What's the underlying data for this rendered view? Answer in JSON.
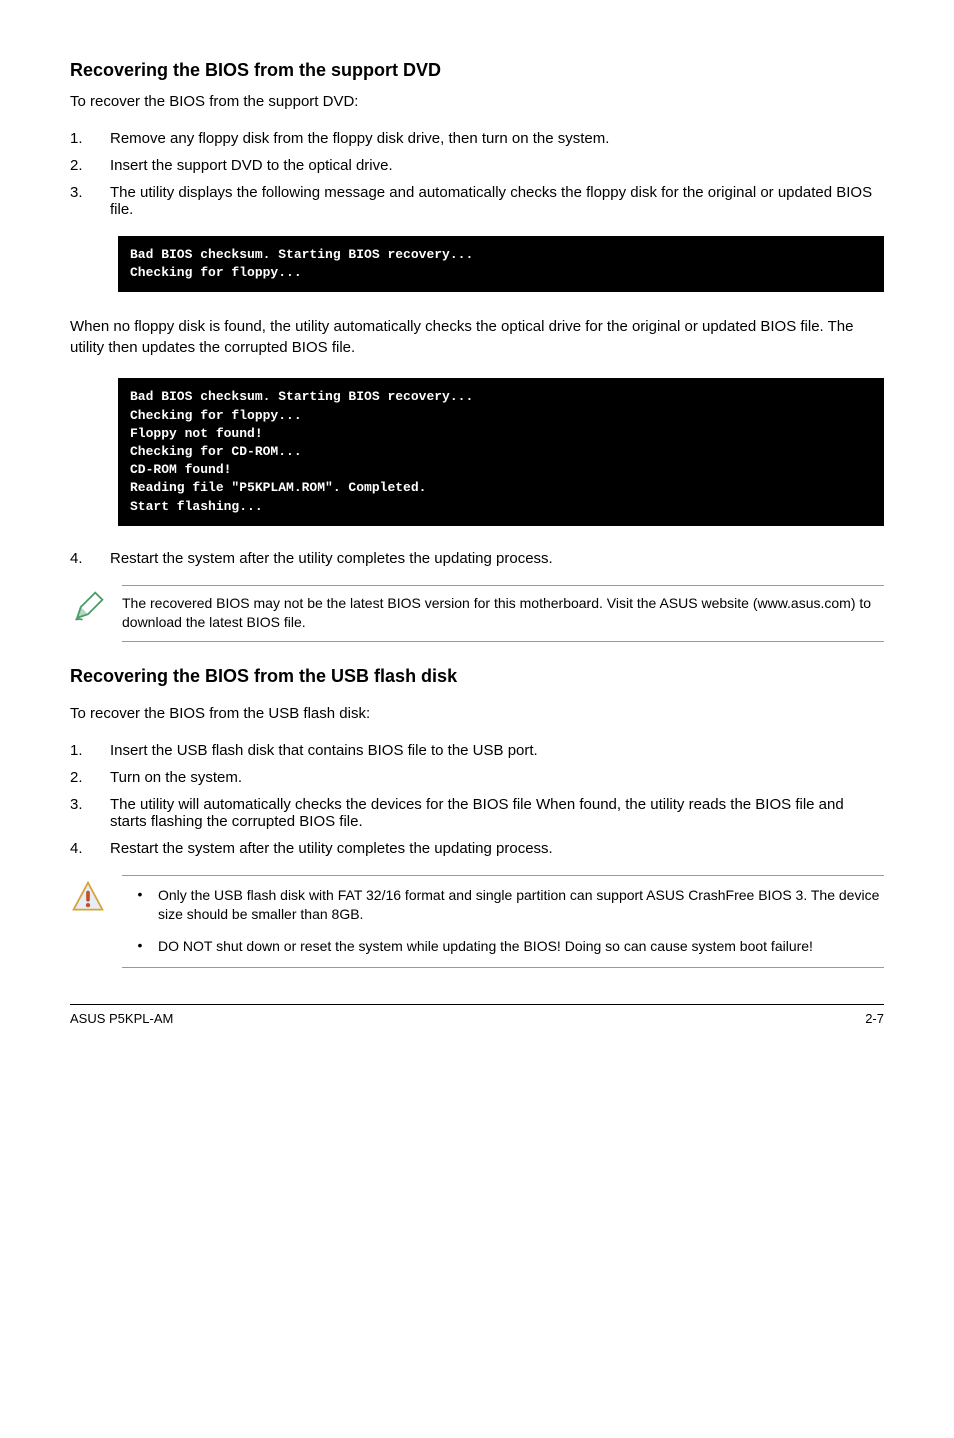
{
  "section1": {
    "heading": "Recovering the BIOS from the support DVD",
    "lead": "To recover the BIOS from the support DVD:",
    "steps": [
      "Remove any floppy disk from the floppy disk drive, then turn on the system.",
      "Insert the support DVD to the optical drive.",
      "The utility displays the following message and automatically checks the floppy disk for the original or updated BIOS file."
    ],
    "code1": "Bad BIOS checksum. Starting BIOS recovery...\nChecking for floppy...",
    "paragraph": "When no floppy disk is found, the utility automatically checks the optical drive for the original or updated BIOS file. The utility then updates the corrupted BIOS file.",
    "code2": "Bad BIOS checksum. Starting BIOS recovery...\nChecking for floppy...\nFloppy not found!\nChecking for CD-ROM...\nCD-ROM found!\nReading file \"P5KPLAM.ROM\". Completed.\nStart flashing...",
    "step4": "Restart the system after the utility completes the updating process.",
    "note": "The recovered BIOS may not be the latest BIOS version for this motherboard. Visit the ASUS website (www.asus.com) to download the latest BIOS file."
  },
  "section2": {
    "heading": "Recovering the BIOS from the USB flash disk",
    "lead": "To recover the BIOS from the USB flash disk:",
    "steps": [
      "Insert the USB flash disk that contains BIOS file to the USB port.",
      "Turn on the system.",
      "The utility will automatically checks the devices for the BIOS file When found, the utility reads the BIOS file and starts flashing the corrupted BIOS file.",
      "Restart the system after the utility completes the updating process."
    ],
    "warnings": [
      "Only the USB flash disk with FAT 32/16 format and single partition can support ASUS CrashFree BIOS 3. The device size should be smaller than 8GB.",
      "DO NOT shut down or reset the system while updating the BIOS! Doing so can cause system boot failure!"
    ]
  },
  "footer": {
    "left": "ASUS P5KPL-AM",
    "right": "2-7"
  }
}
